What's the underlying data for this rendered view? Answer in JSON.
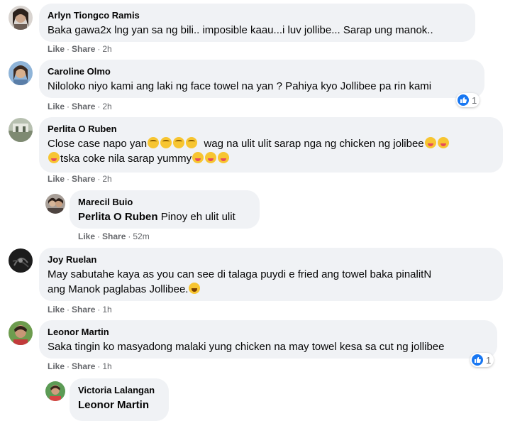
{
  "comments": [
    {
      "author": "Arlyn Tiongco Ramis",
      "text": "Baka gawa2x lng yan sa ng bili.. imposible kaau...i luv jollibe... Sarap ung manok..",
      "like": "Like",
      "share": "Share",
      "time": "2h"
    },
    {
      "author": "Caroline Olmo",
      "text": "Niloloko niyo kami ang laki ng face towel na yan ? Pahiya kyo Jollibee pa rin kami",
      "like": "Like",
      "share": "Share",
      "time": "2h",
      "reaction_count": "1"
    },
    {
      "author": "Perlita O Ruben",
      "text_line1": "Close case napo yan",
      "text_line1b": "wag na ulit ulit sarap nga ng chicken ng jolibee",
      "text_line2": "tska coke nila sarap yummy",
      "like": "Like",
      "share": "Share",
      "time": "2h"
    },
    {
      "author": "Marecil Buio",
      "mention": "Perlita O Ruben",
      "text": "Pinoy eh ulit ulit",
      "like": "Like",
      "share": "Share",
      "time": "52m"
    },
    {
      "author": "Joy Ruelan",
      "text_line1": "May sabutahe kaya as you can see di talaga puydi e fried ang towel baka pinalitN",
      "text_line2": "ang Manok paglabas Jollibee.",
      "like": "Like",
      "share": "Share",
      "time": "1h"
    },
    {
      "author": "Leonor Martin",
      "text": "Saka tingin ko masyadong malaki yung chicken na may towel kesa sa cut ng jollibee",
      "like": "Like",
      "share": "Share",
      "time": "1h",
      "reaction_count": "1"
    },
    {
      "author": "Victoria Lalangan",
      "mention": "Leonor Martin"
    }
  ],
  "separator": "·",
  "colors": {
    "bubble": "#f0f2f5",
    "meta_text": "#65676b",
    "like_blue": "#1877f2"
  },
  "icons": {
    "like_reaction": "thumbs-up-icon",
    "sad_emoji": "sad-face-emoji",
    "yum_emoji": "yum-face-emoji",
    "laugh_emoji": "rofl-emoji"
  }
}
